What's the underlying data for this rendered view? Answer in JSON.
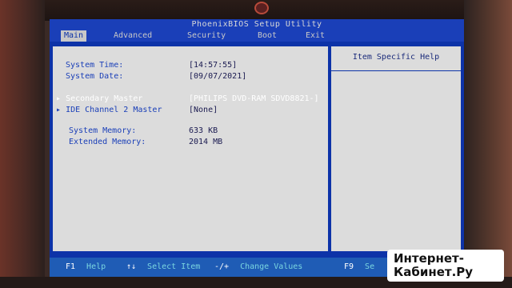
{
  "window_title": "PhoenixBIOS Setup Utility",
  "tabs": [
    {
      "label": "Main",
      "active": true
    },
    {
      "label": "Advanced",
      "active": false
    },
    {
      "label": "Security",
      "active": false
    },
    {
      "label": "Boot",
      "active": false
    },
    {
      "label": "Exit",
      "active": false
    }
  ],
  "main": {
    "system_time_label": "System Time:",
    "system_time_value": "[14:57:55]",
    "system_date_label": "System Date:",
    "system_date_value": "[09/07/2021]",
    "submenus": [
      {
        "label": "Secondary Master",
        "value": "[PHILIPS DVD-RAM SDVD8821-]",
        "selected": true
      },
      {
        "label": "IDE Channel 2 Master",
        "value": "[None]",
        "selected": false
      }
    ],
    "system_memory_label": "System Memory:",
    "system_memory_value": "633 KB",
    "extended_memory_label": "Extended Memory:",
    "extended_memory_value": "2014 MB"
  },
  "help": {
    "title": "Item Specific Help"
  },
  "keys": [
    {
      "key": "F1",
      "desc": "Help"
    },
    {
      "key": "↑↓",
      "desc": "Select Item"
    },
    {
      "key": "-/+",
      "desc": "Change Values"
    },
    {
      "key": "F9",
      "desc": "Se"
    }
  ],
  "watermark": {
    "line1": "Интернет-",
    "line2": "Кабинет.Ру"
  },
  "colors": {
    "bios_blue": "#0d33a8",
    "panel_gray": "#dcdcdc",
    "label_blue": "#1a3fb8",
    "key_cyan": "#7ad6e0"
  }
}
